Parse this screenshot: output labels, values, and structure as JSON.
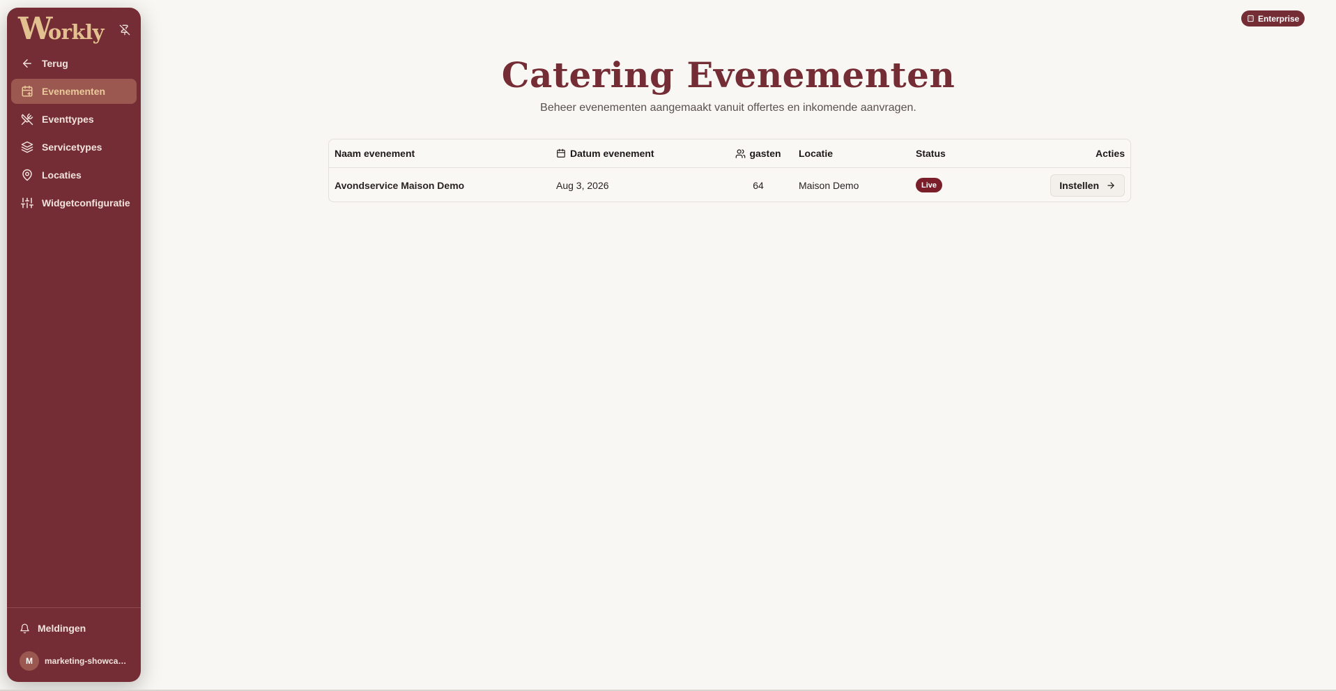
{
  "app": {
    "logo_text_initial": "W",
    "logo_text_rest": "orkly",
    "plan_badge": "Enterprise",
    "brand_color": "#742d35",
    "accent_color": "#e2c08f"
  },
  "sidebar": {
    "back_label": "Terug",
    "items": [
      {
        "label": "Evenementen",
        "icon": "calendar-plus-icon",
        "active": true
      },
      {
        "label": "Eventtypes",
        "icon": "utensils-crossed-icon",
        "active": false
      },
      {
        "label": "Servicetypes",
        "icon": "layers-icon",
        "active": false
      },
      {
        "label": "Locaties",
        "icon": "map-pin-icon",
        "active": false
      },
      {
        "label": "Widgetconfiguratie",
        "icon": "sliders-icon",
        "active": false
      }
    ],
    "notifications_label": "Meldingen",
    "user": {
      "initial": "M",
      "name": "marketing-showcas..."
    }
  },
  "main": {
    "title": "Catering Evenementen",
    "subtitle": "Beheer evenementen aangemaakt vanuit offertes en inkomende aanvragen.",
    "table": {
      "columns": [
        "Naam evenement",
        "Datum evenement",
        "gasten",
        "Locatie",
        "Status",
        "Acties"
      ],
      "rows": [
        {
          "name": "Avondservice Maison Demo",
          "date": "Aug 3, 2026",
          "guests": "64",
          "location": "Maison Demo",
          "status": "Live",
          "action": "Instellen"
        }
      ]
    }
  }
}
